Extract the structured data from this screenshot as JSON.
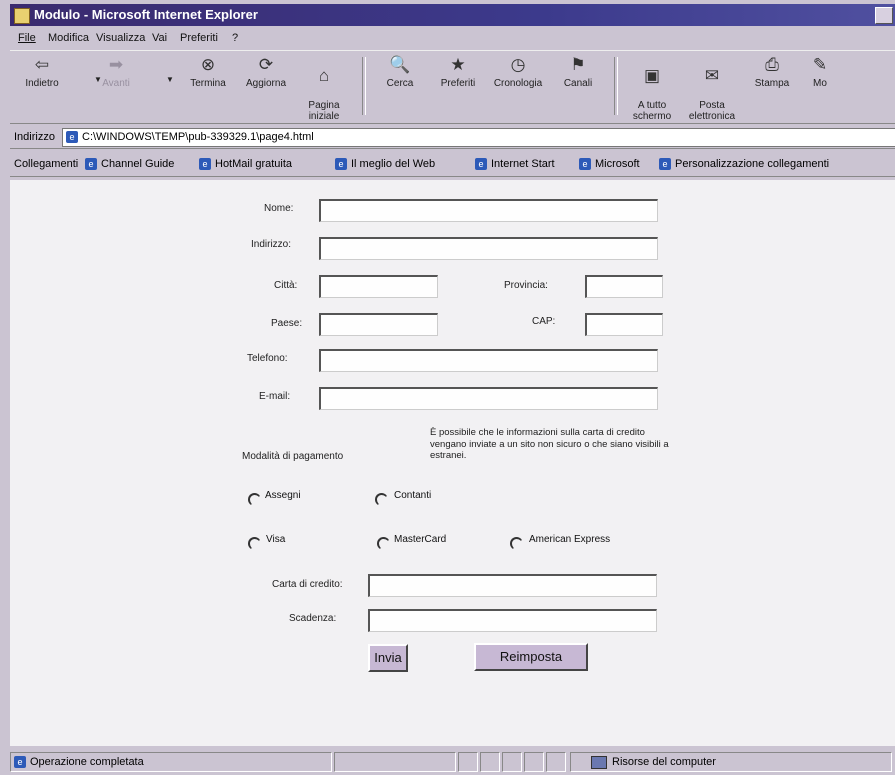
{
  "window": {
    "title": "Modulo - Microsoft Internet Explorer"
  },
  "menu": [
    "File",
    "Modifica",
    "Visualizza",
    "Vai",
    "Preferiti",
    "?"
  ],
  "toolbar": [
    {
      "label": "Indietro",
      "icon": "back-arrow-icon",
      "glyph": "⇦"
    },
    {
      "label": "Avanti",
      "icon": "forward-arrow-icon",
      "glyph": "➡"
    },
    {
      "label": "Termina",
      "icon": "stop-icon",
      "glyph": "⊗"
    },
    {
      "label": "Aggiorna",
      "icon": "refresh-icon",
      "glyph": "⟳"
    },
    {
      "label": "Pagina\niniziale",
      "icon": "home-icon",
      "glyph": "⌂"
    },
    {
      "label": "Cerca",
      "icon": "search-icon",
      "glyph": "🔍"
    },
    {
      "label": "Preferiti",
      "icon": "favorites-icon",
      "glyph": "★"
    },
    {
      "label": "Cronologia",
      "icon": "history-icon",
      "glyph": "◷"
    },
    {
      "label": "Canali",
      "icon": "channels-icon",
      "glyph": "⚑"
    },
    {
      "label": "A tutto\nschermo",
      "icon": "fullscreen-icon",
      "glyph": "▣"
    },
    {
      "label": "Posta\nelettronica",
      "icon": "mail-icon",
      "glyph": "✉"
    },
    {
      "label": "Stampa",
      "icon": "print-icon",
      "glyph": "⎙"
    },
    {
      "label": "Mo",
      "icon": "edit-icon",
      "glyph": "✎"
    }
  ],
  "address": {
    "label": "Indirizzo",
    "value": "C:\\WINDOWS\\TEMP\\pub-339329.1\\page4.html"
  },
  "links": {
    "label": "Collegamenti",
    "items": [
      "Channel Guide",
      "HotMail gratuita",
      "Il meglio del Web",
      "Internet Start",
      "Microsoft",
      "Personalizzazione collegamenti"
    ]
  },
  "form": {
    "nome": "Nome:",
    "indirizzo": "Indirizzo:",
    "citta": "Città:",
    "provincia": "Provincia:",
    "paese": "Paese:",
    "cap": "CAP:",
    "telefono": "Telefono:",
    "email": "E-mail:",
    "pagamento": "Modalità di pagamento",
    "note": "È possibile che le informazioni sulla carta di credito vengano inviate a un sito non sicuro o che siano visibili a estranei.",
    "radios": [
      "Assegni",
      "Contanti",
      "Visa",
      "MasterCard",
      "American Express"
    ],
    "carta": "Carta di credito:",
    "scadenza": "Scadenza:",
    "invia": "Invia",
    "reimposta": "Reimposta"
  },
  "status": {
    "text": "Operazione completata",
    "zone": "Risorse del computer"
  }
}
